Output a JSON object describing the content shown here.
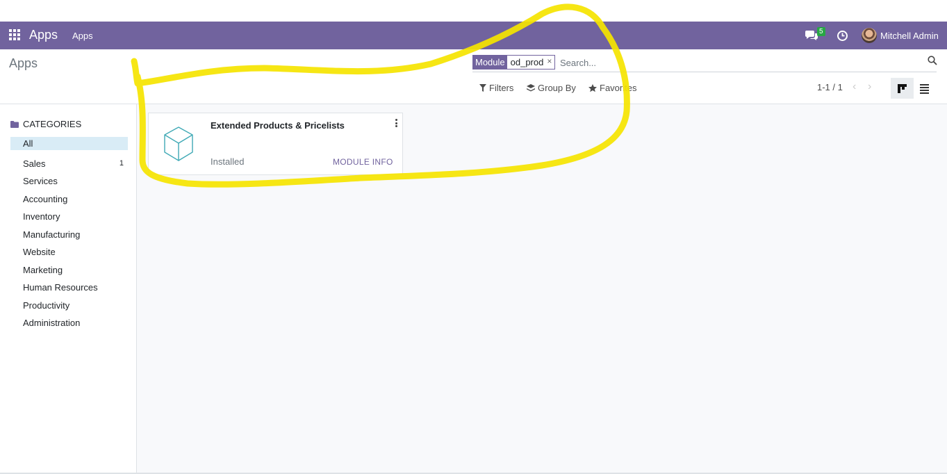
{
  "navbar": {
    "app_title": "Apps",
    "menu_item": "Apps",
    "messages_badge": "5",
    "user_name": "Mitchell Admin",
    "bg_color": "#71639e"
  },
  "control_panel": {
    "breadcrumb": "Apps",
    "search": {
      "facet_label": "Module",
      "facet_value": "od_prod",
      "facet_remove": "×",
      "placeholder": "Search..."
    },
    "filters_label": "Filters",
    "group_by_label": "Group By",
    "favorites_label": "Favorites",
    "pager": "1-1 / 1"
  },
  "sidebar": {
    "header": "CATEGORIES",
    "items": [
      {
        "label": "All",
        "count": ""
      },
      {
        "label": "Sales",
        "count": "1"
      },
      {
        "label": "Services",
        "count": ""
      },
      {
        "label": "Accounting",
        "count": ""
      },
      {
        "label": "Inventory",
        "count": ""
      },
      {
        "label": "Manufacturing",
        "count": ""
      },
      {
        "label": "Website",
        "count": ""
      },
      {
        "label": "Marketing",
        "count": ""
      },
      {
        "label": "Human Resources",
        "count": ""
      },
      {
        "label": "Productivity",
        "count": ""
      },
      {
        "label": "Administration",
        "count": ""
      }
    ]
  },
  "kanban": {
    "cards": [
      {
        "title": "Extended Products & Pricelists",
        "status": "Installed",
        "action": "MODULE INFO",
        "icon": "cube-icon"
      }
    ]
  },
  "colors": {
    "accent": "#71639e",
    "badge": "#28a745",
    "annotation": "#f5e400"
  }
}
